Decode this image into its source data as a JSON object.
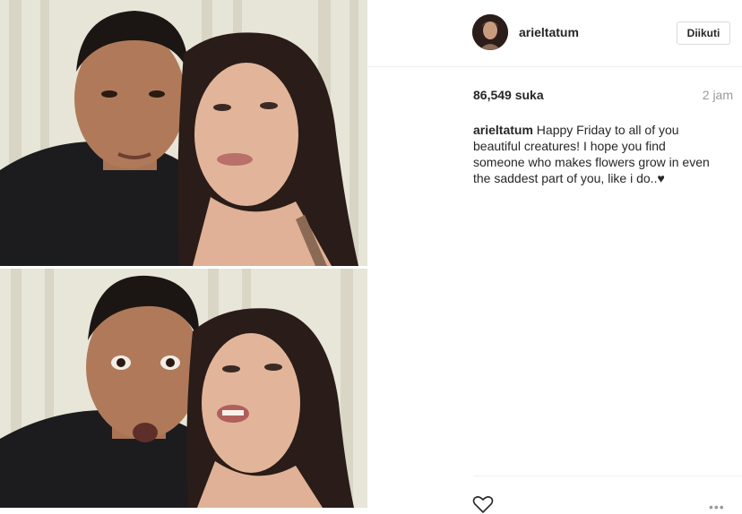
{
  "post": {
    "username": "arieltatum",
    "follow_label": "Diikuti",
    "likes": "86,549 suka",
    "time": "2 jam",
    "caption_user": "arieltatum",
    "caption_text": " Happy Friday to all of you beautiful creatures! I hope you find someone who makes flowers grow in even the saddest part of you, like i do..♥",
    "more_label": "•••"
  },
  "icons": {
    "heart": "heart-icon",
    "more": "more-options-icon"
  }
}
